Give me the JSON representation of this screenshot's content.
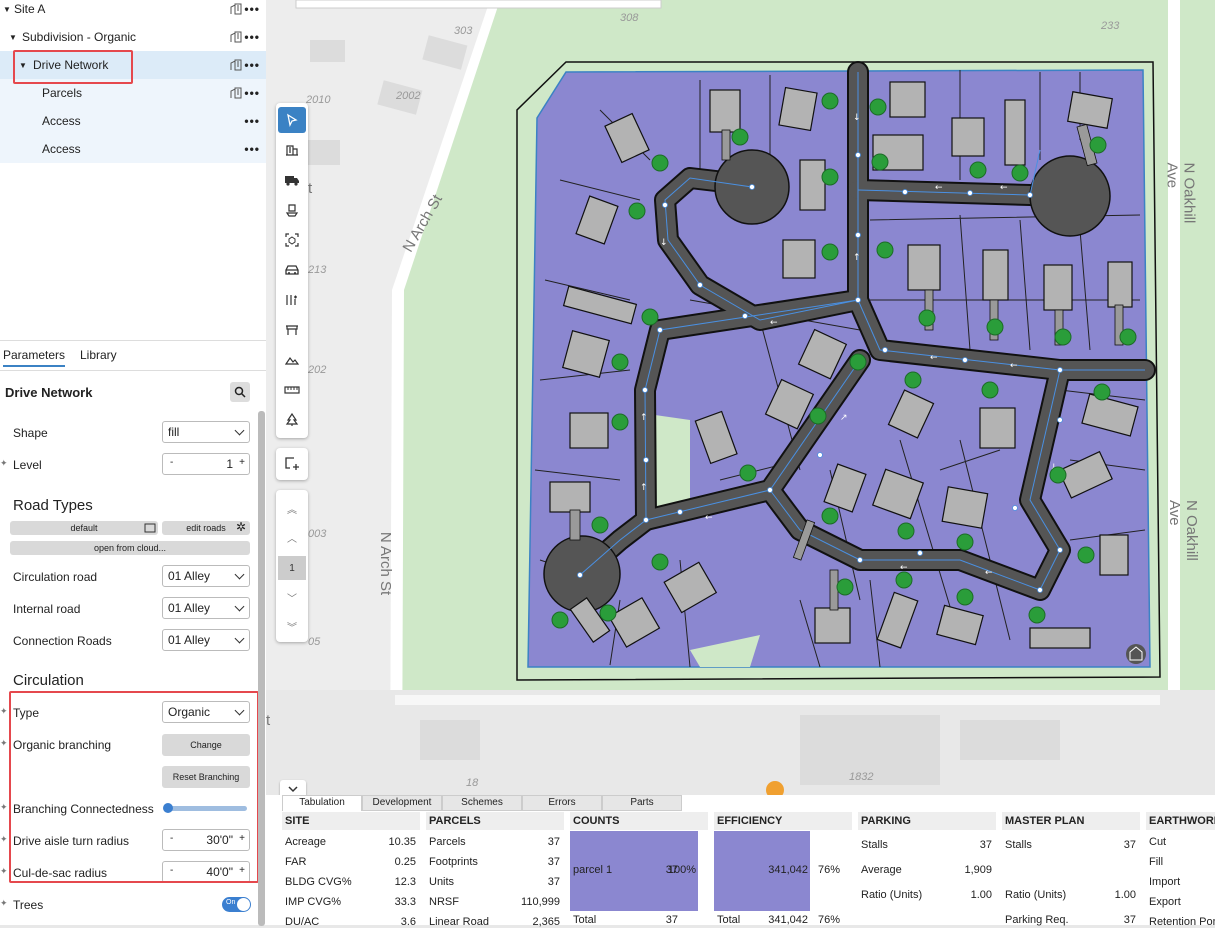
{
  "tree": {
    "items": [
      {
        "label": "Site A"
      },
      {
        "label": "Subdivision - Organic"
      },
      {
        "label": "Drive Network"
      },
      {
        "label": "Parcels"
      },
      {
        "label": "Access"
      },
      {
        "label": "Access"
      }
    ]
  },
  "params": {
    "tabs": [
      "Parameters",
      "Library"
    ],
    "title": "Drive Network",
    "shape_label": "Shape",
    "shape_value": "fill",
    "level_label": "Level",
    "level_value": "1",
    "road_types_heading": "Road Types",
    "default_btn": "default",
    "edit_roads_btn": "edit roads",
    "open_cloud_btn": "open from cloud...",
    "circulation_road_label": "Circulation road",
    "circulation_road_value": "01 Alley",
    "internal_road_label": "Internal road",
    "internal_road_value": "01 Alley",
    "connection_roads_label": "Connection Roads",
    "connection_roads_value": "01 Alley",
    "circulation_heading": "Circulation",
    "type_label": "Type",
    "type_value": "Organic",
    "organic_branching_label": "Organic branching",
    "change_btn": "Change",
    "reset_branching_btn": "Reset Branching",
    "branching_connectedness_label": "Branching Connectedness",
    "branching_connectedness_value": 0.0,
    "drive_aisle_label": "Drive aisle turn radius",
    "drive_aisle_value": "30'0\"",
    "culdesac_label": "Cul-de-sac radius",
    "culdesac_value": "40'0\"",
    "trees_label": "Trees",
    "trees_toggle": "On",
    "stepper_minus": "-",
    "stepper_plus": "+"
  },
  "map": {
    "streets": [
      "N Arch St",
      "N Arch St",
      "N Oakhill Ave",
      "N Oakhill Ave"
    ],
    "house_numbers": [
      "308",
      "303",
      "233",
      "2010",
      "2002",
      "213",
      "202",
      "003",
      "05",
      "18",
      "1832"
    ],
    "clipped_labels": [
      "t",
      "t"
    ]
  },
  "pager": {
    "current": "1"
  },
  "bottom": {
    "tabs": [
      "Tabulation",
      "Development",
      "Schemes",
      "Errors",
      "Parts"
    ],
    "site": {
      "title": "SITE",
      "rows": [
        [
          "Acreage",
          "10.35"
        ],
        [
          "FAR",
          "0.25"
        ],
        [
          "BLDG CVG%",
          "12.3"
        ],
        [
          "IMP CVG%",
          "33.3"
        ],
        [
          "DU/AC",
          "3.6"
        ]
      ]
    },
    "parcels": {
      "title": "PARCELS",
      "rows": [
        [
          "Parcels",
          "37"
        ],
        [
          "Footprints",
          "37"
        ],
        [
          "Units",
          "37"
        ],
        [
          "NRSF",
          "110,999"
        ],
        [
          "Linear Road",
          "2,365"
        ]
      ]
    },
    "counts": {
      "title": "COUNTS",
      "item": "parcel 1",
      "value": "37",
      "pct": "100%",
      "total_label": "Total",
      "total": "37"
    },
    "efficiency": {
      "title": "EFFICIENCY",
      "value": "341,042",
      "pct": "76%",
      "total_label": "Total",
      "total": "341,042",
      "total_pct": "76%"
    },
    "parking": {
      "title": "PARKING",
      "rows": [
        [
          "Stalls",
          "37"
        ],
        [
          "Average",
          "1,909"
        ],
        [
          "Ratio (Units)",
          "1.00"
        ]
      ]
    },
    "master_plan": {
      "title": "MASTER PLAN",
      "rows": [
        [
          "Stalls",
          "37"
        ],
        [
          "Ratio (Units)",
          "1.00"
        ],
        [
          "Parking Req.",
          "37"
        ]
      ]
    },
    "earthwork": {
      "title": "EARTHWORK",
      "rows": [
        "Cut",
        "Fill",
        "Import",
        "Export",
        "Retention Pon"
      ]
    }
  },
  "colors": {
    "parcel": "#8b87d0",
    "road": "#555555",
    "accent": "#3b82c4",
    "highlight": "#e5484d",
    "tree": "#2a9d3a"
  }
}
